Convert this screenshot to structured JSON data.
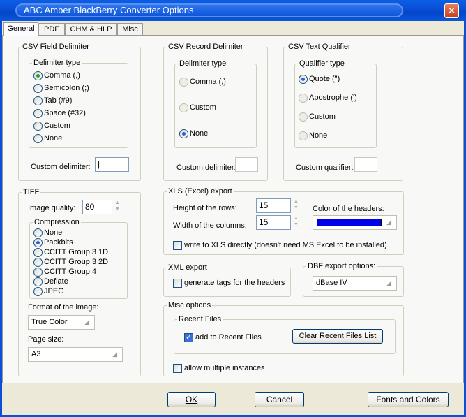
{
  "window": {
    "title": "ABC Amber BlackBerry Converter Options",
    "close_glyph": "✕"
  },
  "tabs": [
    {
      "label": "General"
    },
    {
      "label": "PDF"
    },
    {
      "label": "CHM & HLP"
    },
    {
      "label": "Misc"
    }
  ],
  "csv_field": {
    "title": "CSV Field Delimiter",
    "type_title": "Delimiter type",
    "options": [
      "Comma (,)",
      "Semicolon (;)",
      "Tab (#9)",
      "Space (#32)",
      "Custom",
      "None"
    ],
    "selected": "Comma (,)",
    "custom_label": "Custom delimiter:",
    "custom_value": "|"
  },
  "csv_record": {
    "title": "CSV Record Delimiter",
    "type_title": "Delimiter type",
    "options": [
      "Comma (,)",
      "Custom",
      "None"
    ],
    "selected": "None",
    "custom_label": "Custom delimiter:",
    "custom_value": ""
  },
  "csv_text": {
    "title": "CSV Text Qualifier",
    "type_title": "Qualifier type",
    "options": [
      "Quote (\")",
      "Apostrophe (')",
      "Custom",
      "None"
    ],
    "selected": "Quote (\")",
    "custom_label": "Custom qualifier:",
    "custom_value": ""
  },
  "tiff": {
    "title": "TIFF",
    "quality_label": "Image quality:",
    "quality_value": "80",
    "compression_title": "Compression",
    "compression_options": [
      "None",
      "Packbits",
      "CCITT Group 3 1D",
      "CCITT Group 3 2D",
      "CCITT Group 4",
      "Deflate",
      "JPEG"
    ],
    "compression_selected": "Packbits",
    "format_label": "Format of the image:",
    "format_value": "True Color",
    "page_size_label": "Page size:",
    "page_size_value": "A3"
  },
  "xls": {
    "title": "XLS (Excel) export",
    "row_height_label": "Height of the rows:",
    "row_height_value": "15",
    "col_width_label": "Width of the columns:",
    "col_width_value": "15",
    "header_color_label": "Color of the headers:",
    "header_color": "#0000e8",
    "direct_label": "write to XLS directly (doesn't need MS Excel to be installed)",
    "direct_checked": false
  },
  "xml": {
    "title": "XML export",
    "tags_label": "generate tags for the headers",
    "tags_checked": false
  },
  "dbf": {
    "title": "DBF export options:",
    "value": "dBase IV"
  },
  "misc": {
    "title": "Misc options",
    "recent_title": "Recent Files",
    "add_recent_label": "add to Recent Files",
    "add_recent_checked": true,
    "clear_button": "Clear Recent Files List",
    "multi_label": "allow multiple instances",
    "multi_checked": false
  },
  "buttons": {
    "ok": "OK",
    "cancel": "Cancel",
    "fonts": "Fonts and Colors"
  },
  "icons": {
    "spin_up": "▲",
    "spin_down": "▼",
    "combo_arrow": "◢"
  }
}
